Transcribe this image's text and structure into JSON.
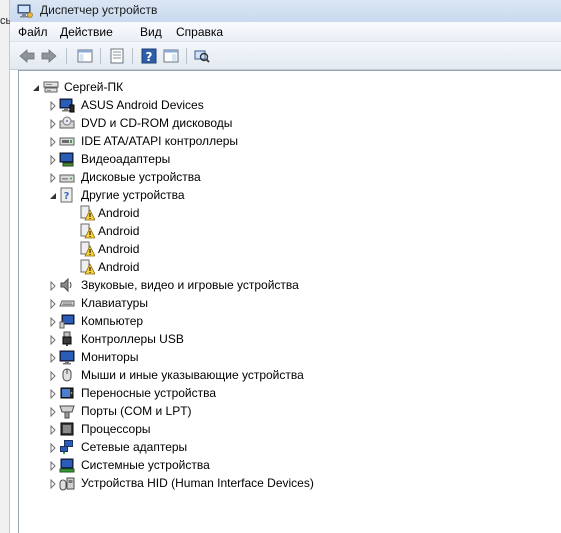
{
  "behind_window": {
    "text": "сь"
  },
  "window": {
    "title": "Диспетчер устройств"
  },
  "menu": [
    "Файл",
    "Действие",
    "Вид",
    "Справка"
  ],
  "toolbar": {
    "buttons": [
      "back-arrow-icon",
      "forward-arrow-icon",
      "show-hide-console-tree-icon",
      "properties-icon",
      "help-icon",
      "action-pane-icon",
      "scan-hardware-icon"
    ]
  },
  "tree": {
    "root": {
      "label": "Сергей-ПК",
      "icon": "computer-icon",
      "expanded": true
    },
    "nodes": [
      {
        "label": "ASUS Android Devices",
        "icon": "asus-android-device-icon",
        "expanded": false
      },
      {
        "label": "DVD и CD-ROM дисководы",
        "icon": "dvd-drive-icon",
        "expanded": false
      },
      {
        "label": "IDE ATA/ATAPI контроллеры",
        "icon": "ide-controller-icon",
        "expanded": false
      },
      {
        "label": "Видеоадаптеры",
        "icon": "display-adapter-icon",
        "expanded": false
      },
      {
        "label": "Дисковые устройства",
        "icon": "disk-drive-icon",
        "expanded": false
      },
      {
        "label": "Другие устройства",
        "icon": "other-devices-icon",
        "expanded": true,
        "children": [
          {
            "label": "Android",
            "icon": "warning-device-icon"
          },
          {
            "label": "Android",
            "icon": "warning-device-icon"
          },
          {
            "label": "Android",
            "icon": "warning-device-icon"
          },
          {
            "label": "Android",
            "icon": "warning-device-icon"
          }
        ]
      },
      {
        "label": "Звуковые, видео и игровые устройства",
        "icon": "sound-device-icon",
        "expanded": false
      },
      {
        "label": "Клавиатуры",
        "icon": "keyboard-icon",
        "expanded": false
      },
      {
        "label": "Компьютер",
        "icon": "computer-icon",
        "expanded": false
      },
      {
        "label": "Контроллеры USB",
        "icon": "usb-controller-icon",
        "expanded": false
      },
      {
        "label": "Мониторы",
        "icon": "monitor-icon",
        "expanded": false
      },
      {
        "label": "Мыши и иные указывающие устройства",
        "icon": "mouse-icon",
        "expanded": false
      },
      {
        "label": "Переносные устройства",
        "icon": "portable-device-icon",
        "expanded": false
      },
      {
        "label": "Порты (COM и LPT)",
        "icon": "port-icon",
        "expanded": false
      },
      {
        "label": "Процессоры",
        "icon": "processor-icon",
        "expanded": false
      },
      {
        "label": "Сетевые адаптеры",
        "icon": "network-adapter-icon",
        "expanded": false
      },
      {
        "label": "Системные устройства",
        "icon": "system-device-icon",
        "expanded": false
      },
      {
        "label": "Устройства HID (Human Interface Devices)",
        "icon": "hid-device-icon",
        "expanded": false
      }
    ]
  }
}
